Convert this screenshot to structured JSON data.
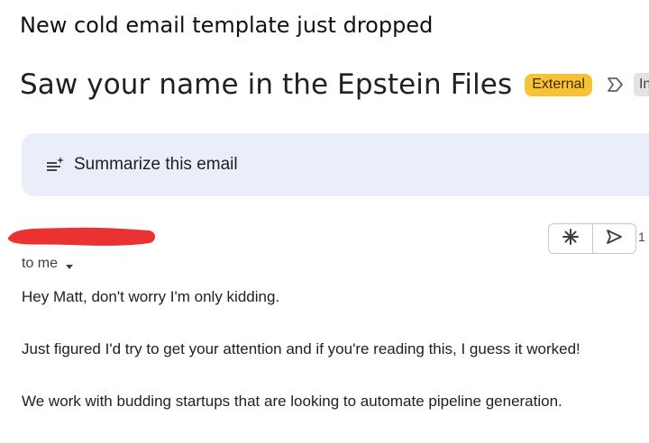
{
  "caption": "New cold email template just dropped",
  "email": {
    "subject": "Saw your name in the Epstein Files",
    "labels": {
      "external": "External",
      "inbox": "Inbox"
    },
    "summarize_label": "Summarize this email",
    "recipient_line": "to me",
    "trailing_text": "1",
    "body_lines": [
      "Hey Matt, don't worry I'm only kidding.",
      "Just figured I'd try to get your attention and if you're reading this, I guess it worked!",
      "We work with budding startups that are looking to automate pipeline generation."
    ]
  },
  "colors": {
    "external_badge": "#f8c236",
    "summarize_bg": "#e9eef8",
    "redaction": "#ea3232"
  },
  "icons": [
    "label-arrow-icon",
    "summarize-icon",
    "sparkle-icon",
    "send-icon",
    "caret-down-icon"
  ]
}
